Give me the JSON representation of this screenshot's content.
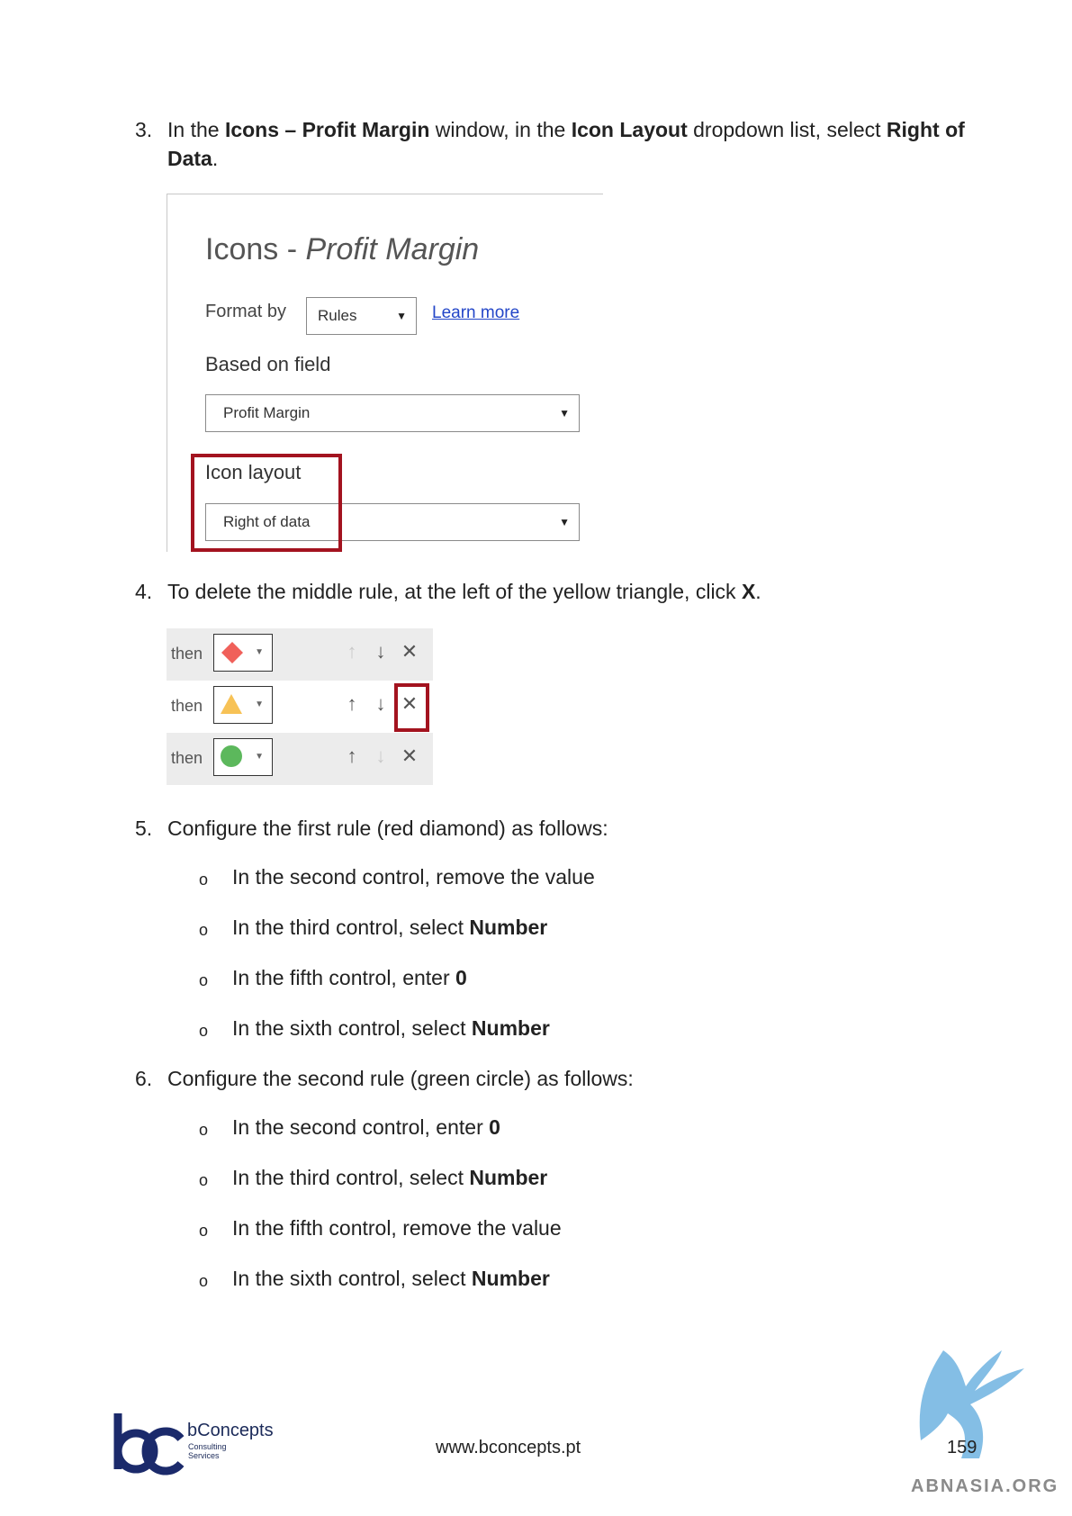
{
  "step3": {
    "number": "3.",
    "t1": "In the ",
    "b1": "Icons – Profit Margin",
    "t2": " window, in the ",
    "b2": "Icon Layout",
    "t3": " dropdown list, select ",
    "b3": "Right of Data",
    "t4": "."
  },
  "dialog": {
    "title_plain": "Icons - ",
    "title_italic": "Profit Margin",
    "format_by_label": "Format by",
    "format_by_value": "Rules",
    "learn_more": "Learn more",
    "based_on_label": "Based on field",
    "based_on_value": "Profit Margin",
    "icon_layout_label": "Icon layout",
    "icon_layout_value": "Right of data"
  },
  "step4": {
    "number": "4.",
    "t1": "To delete the middle rule, at the left of the yellow triangle, click ",
    "b1": "X",
    "t2": "."
  },
  "rules": {
    "then_label": "then",
    "rows": [
      {
        "icon": "red-diamond-icon",
        "up_enabled": false,
        "down_enabled": true
      },
      {
        "icon": "yellow-triangle-icon",
        "up_enabled": true,
        "down_enabled": true,
        "highlighted_delete": true
      },
      {
        "icon": "green-circle-icon",
        "up_enabled": true,
        "down_enabled": false
      }
    ],
    "colors": {
      "diamond": "#f0605a",
      "triangle": "#f7c256",
      "circle": "#5cb85c",
      "highlight": "#a3131f"
    }
  },
  "step5": {
    "number": "5.",
    "text": "Configure the first rule (red diamond) as follows:",
    "items": [
      {
        "t": "In the second control, remove the value",
        "b": ""
      },
      {
        "t": "In the third control, select ",
        "b": "Number"
      },
      {
        "t": "In the fifth control, enter ",
        "b": "0"
      },
      {
        "t": "In the sixth control, select ",
        "b": "Number"
      }
    ]
  },
  "step6": {
    "number": "6.",
    "text": "Configure the second rule (green circle) as follows:",
    "items": [
      {
        "t": "In the second control, enter ",
        "b": "0"
      },
      {
        "t": "In the third control, select ",
        "b": "Number"
      },
      {
        "t": "In the fifth control, remove the value",
        "b": ""
      },
      {
        "t": "In the sixth control, select ",
        "b": "Number"
      }
    ]
  },
  "bullet_glyph": "o",
  "footer": {
    "brand_name": "bConcepts",
    "brand_sub1": "Consulting",
    "brand_sub2": "Services",
    "url": "www.bconcepts.pt",
    "page_number": "159",
    "watermark": "ABNASIA.ORG"
  }
}
